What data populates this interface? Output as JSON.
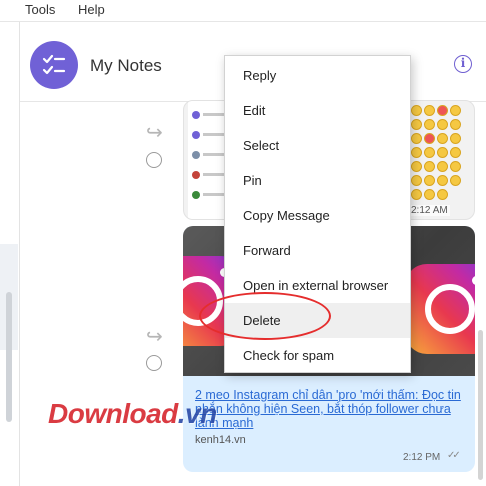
{
  "menubar": {
    "items": [
      "Tools",
      "Help"
    ]
  },
  "header": {
    "title": "My Notes",
    "info_icon": "info-icon",
    "avatar_icon": "checklist-icon",
    "avatar_color": "#7061d6"
  },
  "context_menu": {
    "items": [
      "Reply",
      "Edit",
      "Select",
      "Pin",
      "Copy Message",
      "Forward",
      "Open in external browser",
      "Delete",
      "Check for spam"
    ],
    "highlighted": "Delete"
  },
  "messages": [
    {
      "type": "image",
      "timestamp": "2:12 AM"
    },
    {
      "type": "link",
      "link_text": "2 meo Instagram chỉ dân 'pro 'mới thấm: Đọc tin nhắn không hiện Seen, bắt thóp follower chưa lành mạnh",
      "domain": "kenh14.vn",
      "timestamp": "2:12 PM"
    }
  ],
  "watermark": {
    "part1": "Download",
    "part2": ".vn"
  },
  "colors": {
    "accent": "#6f5fd1",
    "link": "#2a6ad4",
    "bubble": "#dbeeff",
    "annotation": "#e52d2d"
  }
}
